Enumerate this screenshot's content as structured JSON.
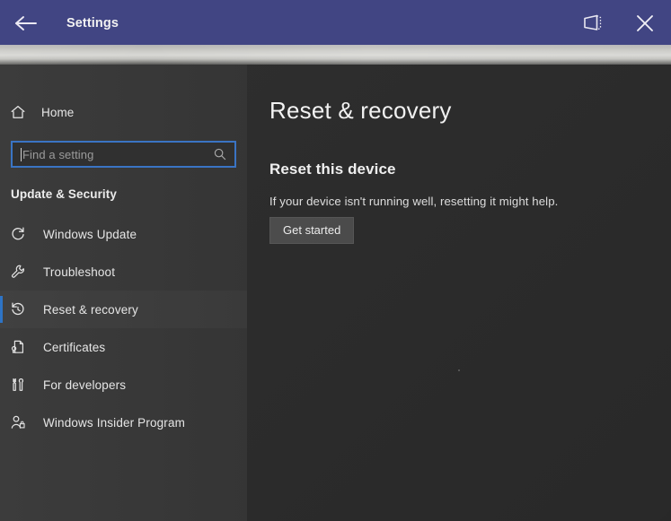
{
  "window": {
    "titlebar": {
      "title": "Settings",
      "back_icon": "back-arrow-icon",
      "tablet_icon": "tablet-mode-icon",
      "close_icon": "close-icon",
      "accent_color": "#414583"
    }
  },
  "sidebar": {
    "home": {
      "label": "Home",
      "icon": "home-icon"
    },
    "search": {
      "value": "",
      "placeholder": "Find a setting",
      "icon": "search-icon",
      "focus_color": "#3a74c4"
    },
    "section_heading": "Update & Security",
    "items": [
      {
        "label": "Windows Update",
        "icon": "sync-icon",
        "selected": false
      },
      {
        "label": "Troubleshoot",
        "icon": "wrench-icon",
        "selected": false
      },
      {
        "label": "Reset & recovery",
        "icon": "history-clock-icon",
        "selected": true
      },
      {
        "label": "Certificates",
        "icon": "certificate-icon",
        "selected": false
      },
      {
        "label": "For developers",
        "icon": "developer-tools-icon",
        "selected": false
      },
      {
        "label": "Windows Insider Program",
        "icon": "insider-person-icon",
        "selected": false
      }
    ],
    "selection_color": "#2e74c6",
    "background_color": "#383838"
  },
  "main": {
    "page_title": "Reset & recovery",
    "sections": [
      {
        "heading": "Reset this device",
        "description": "If your device isn't running well, resetting it might help.",
        "button_label": "Get started"
      }
    ],
    "background_color": "#2b2b2b"
  }
}
